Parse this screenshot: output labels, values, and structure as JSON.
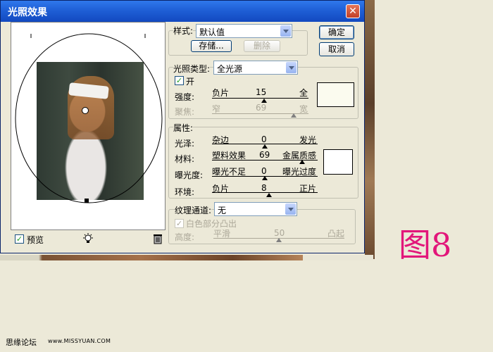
{
  "window": {
    "title": "光照效果",
    "close_glyph": "✕"
  },
  "preview": {
    "checkbox_label": "预览",
    "checked": true,
    "bulb_icon": "light-bulb-icon",
    "trash_icon": "trash-icon"
  },
  "buttons": {
    "ok": "确定",
    "cancel": "取消",
    "save": "存储...",
    "delete": "删除"
  },
  "style": {
    "label": "样式:",
    "value": "默认值"
  },
  "light": {
    "type_label": "光照类型:",
    "type_value": "全光源",
    "on_label": "开",
    "on_checked": true,
    "intensity": {
      "label": "强度:",
      "left": "负片",
      "right": "全",
      "value": "15",
      "fraction": 0.54
    },
    "focus": {
      "label": "聚焦:",
      "left": "窄",
      "right": "宽",
      "value": "69",
      "fraction": 0.85
    },
    "color": "#fbfbef"
  },
  "properties": {
    "label": "属性:",
    "gloss": {
      "label": "光泽:",
      "left": "杂边",
      "right": "发光",
      "value": "0",
      "fraction": 0.5
    },
    "material": {
      "label": "材料:",
      "left": "塑料效果",
      "right": "金属质感",
      "value": "69",
      "fraction": 0.85
    },
    "exposure": {
      "label": "曝光度:",
      "left": "曝光不足",
      "right": "曝光过度",
      "value": "0",
      "fraction": 0.5
    },
    "ambience": {
      "label": "环境:",
      "left": "负片",
      "right": "正片",
      "value": "8",
      "fraction": 0.54
    },
    "color": "#ffffff"
  },
  "texture": {
    "channel_label": "纹理通道:",
    "channel_value": "无",
    "white_high_label": "白色部分凸出",
    "height": {
      "label": "高度:",
      "left": "平滑",
      "right": "凸起",
      "value": "50",
      "fraction": 0.5
    }
  },
  "figure_label": "图8",
  "watermark": {
    "site_name": "思缘论坛",
    "url": "www.MISSYUAN.COM"
  }
}
